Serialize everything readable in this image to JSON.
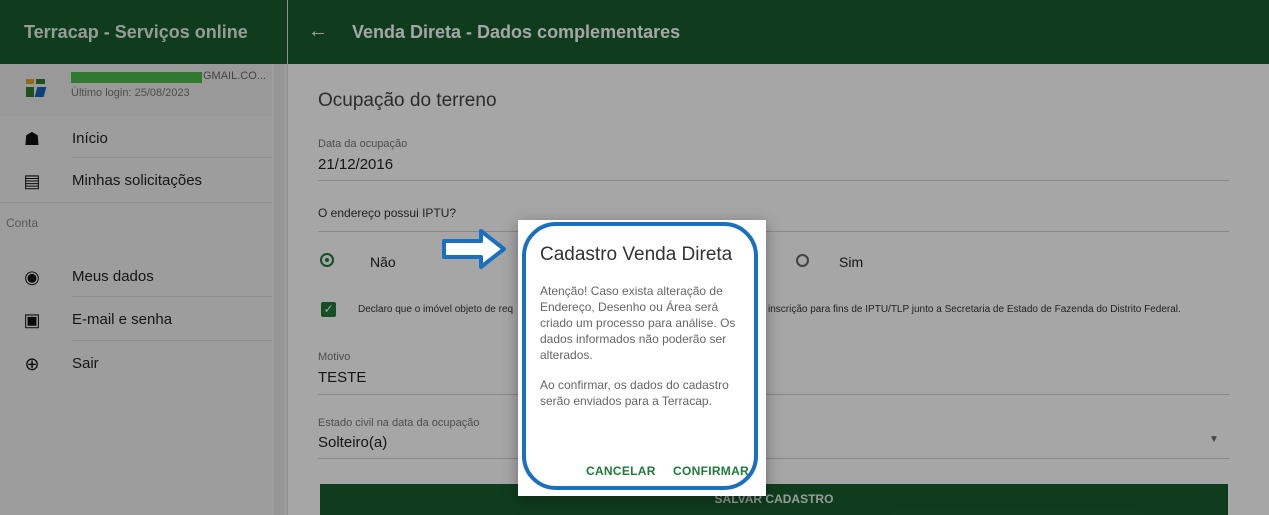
{
  "app": {
    "title": "Terracap - Serviços online",
    "page_title": "Venda Direta - Dados complementares",
    "brand_color": "#1a5c2e"
  },
  "sidebar": {
    "user": {
      "email_suffix": "GMAIL.CO...",
      "last_login": "Último login: 25/08/2023"
    },
    "items": [
      {
        "label": "Início",
        "icon": "home-icon"
      },
      {
        "label": "Minhas solicitações",
        "icon": "inbox-icon"
      }
    ],
    "section_label": "Conta",
    "account_items": [
      {
        "label": "Meus dados",
        "icon": "account-circle-icon"
      },
      {
        "label": "E-mail e senha",
        "icon": "lock-icon"
      },
      {
        "label": "Sair",
        "icon": "logout-icon"
      }
    ]
  },
  "form": {
    "section_title": "Ocupação do terreno",
    "date_label": "Data da ocupação",
    "date_value": "21/12/2016",
    "iptu_question": "O endereço possui IPTU?",
    "iptu_options": [
      "Não",
      "Sim"
    ],
    "iptu_selected": "Não",
    "declaration_left": "Declaro que o imóvel objeto de req",
    "declaration_right": "inscrição para fins de IPTU/TLP junto a Secretaria de Estado de Fazenda do Distrito Federal.",
    "motivo_label": "Motivo",
    "motivo_value": "TESTE",
    "civil_label": "Estado civil na data da ocupação",
    "civil_value": "Solteiro(a)",
    "save_button": "SALVAR CADASTRO"
  },
  "dialog": {
    "title": "Cadastro Venda Direta",
    "body1": "Atenção! Caso exista alteração de Endereço, Desenho ou Área será criado um processo para análise. Os dados informados não poderão ser alterados.",
    "body2": "Ao confirmar, os dados do cadastro serão enviados para a Terracap.",
    "cancel": "CANCELAR",
    "confirm": "CONFIRMAR"
  },
  "annotations": {
    "arrow_color": "#1a6fbf",
    "highlight_color": "#1a6fbf"
  }
}
